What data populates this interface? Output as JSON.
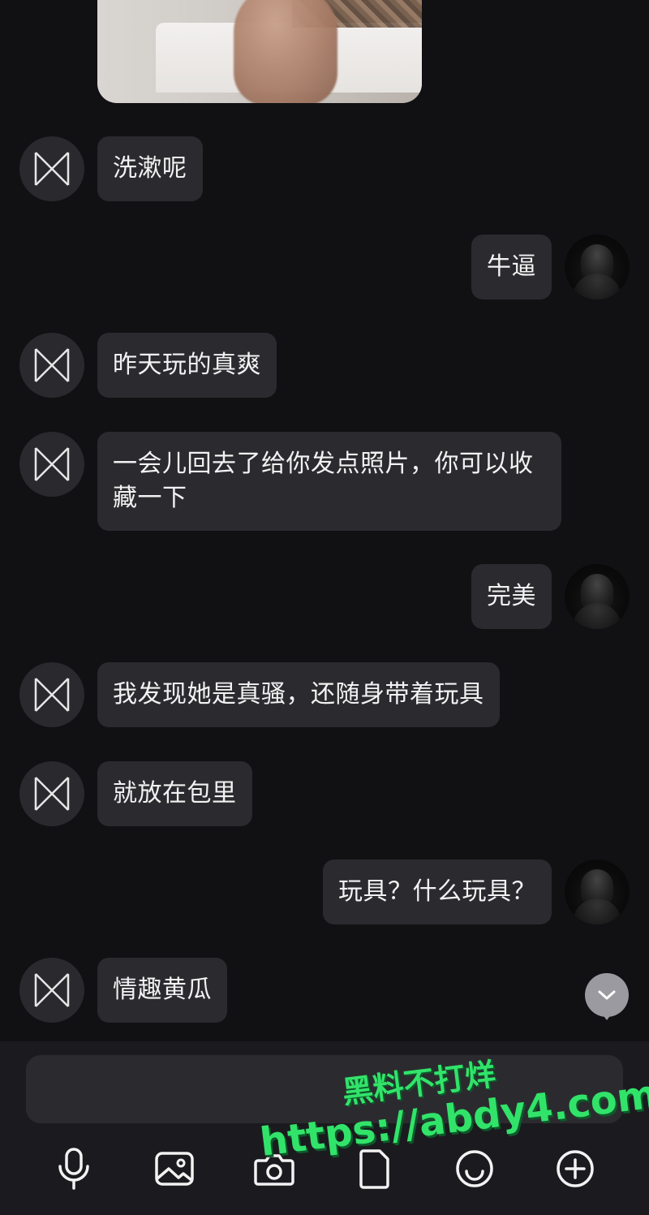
{
  "messages": [
    {
      "side": "in",
      "text": "洗漱呢"
    },
    {
      "side": "out",
      "text": "牛逼"
    },
    {
      "side": "in",
      "text": "昨天玩的真爽"
    },
    {
      "side": "in",
      "text": "一会儿回去了给你发点照片，你可以收藏一下"
    },
    {
      "side": "out",
      "text": "完美"
    },
    {
      "side": "in",
      "text": "我发现她是真骚，还随身带着玩具"
    },
    {
      "side": "in",
      "text": "就放在包里"
    },
    {
      "side": "out",
      "text": "玩具？什么玩具？"
    },
    {
      "side": "in",
      "text": "情趣黄瓜"
    }
  ],
  "composer": {
    "placeholder": ""
  },
  "toolbar": {
    "icons": [
      "microphone-icon",
      "image-icon",
      "camera-icon",
      "file-icon",
      "emoji-icon",
      "plus-circle-icon"
    ]
  },
  "watermark": {
    "line1": "黑料不打烊",
    "line2": "https://abdy4.com"
  },
  "colors": {
    "background": "#111114",
    "bubble": "#2b2b2f",
    "composer": "#1b1b1f",
    "watermark": "#32e36a"
  }
}
